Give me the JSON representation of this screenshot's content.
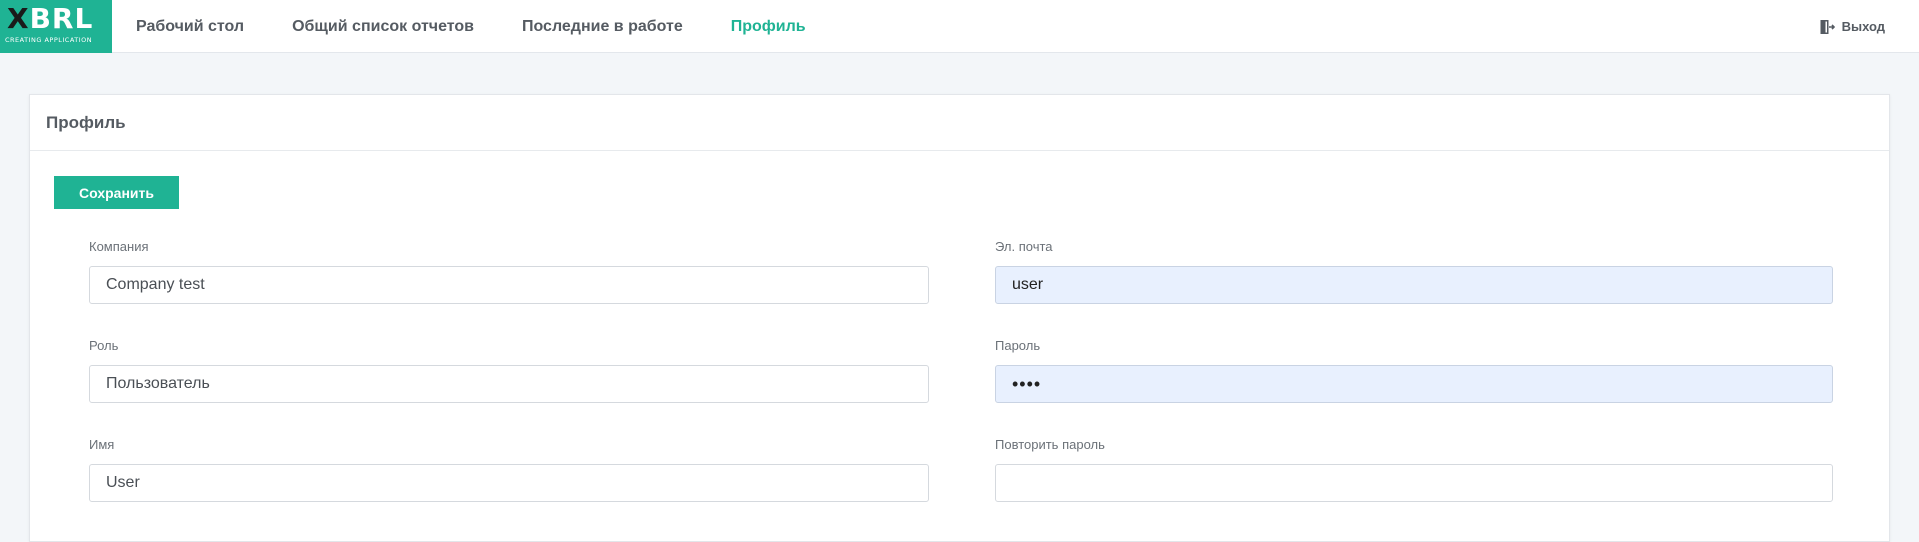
{
  "logo": {
    "main_x": "X",
    "main_rest": "BRL",
    "sub": "CREATING APPLICATION"
  },
  "nav": {
    "items": [
      {
        "label": "Рабочий стол",
        "active": false
      },
      {
        "label": "Общий список отчетов",
        "active": false
      },
      {
        "label": "Последние в работе",
        "active": false
      },
      {
        "label": "Профиль",
        "active": true
      }
    ]
  },
  "logout": {
    "label": "Выход",
    "icon": "logout-icon"
  },
  "panel": {
    "title": "Профиль",
    "save_label": "Сохранить"
  },
  "form": {
    "company": {
      "label": "Компания",
      "value": "Company test"
    },
    "role": {
      "label": "Роль",
      "value": "Пользователь"
    },
    "name": {
      "label": "Имя",
      "value": "User"
    },
    "email": {
      "label": "Эл. почта",
      "value": "user"
    },
    "password": {
      "label": "Пароль",
      "value": "••••"
    },
    "password_repeat": {
      "label": "Повторить пароль",
      "value": ""
    }
  },
  "colors": {
    "accent": "#1fb394",
    "autofill": "#e8f0fe",
    "background": "#f3f6f9",
    "text_muted": "#555b62"
  }
}
